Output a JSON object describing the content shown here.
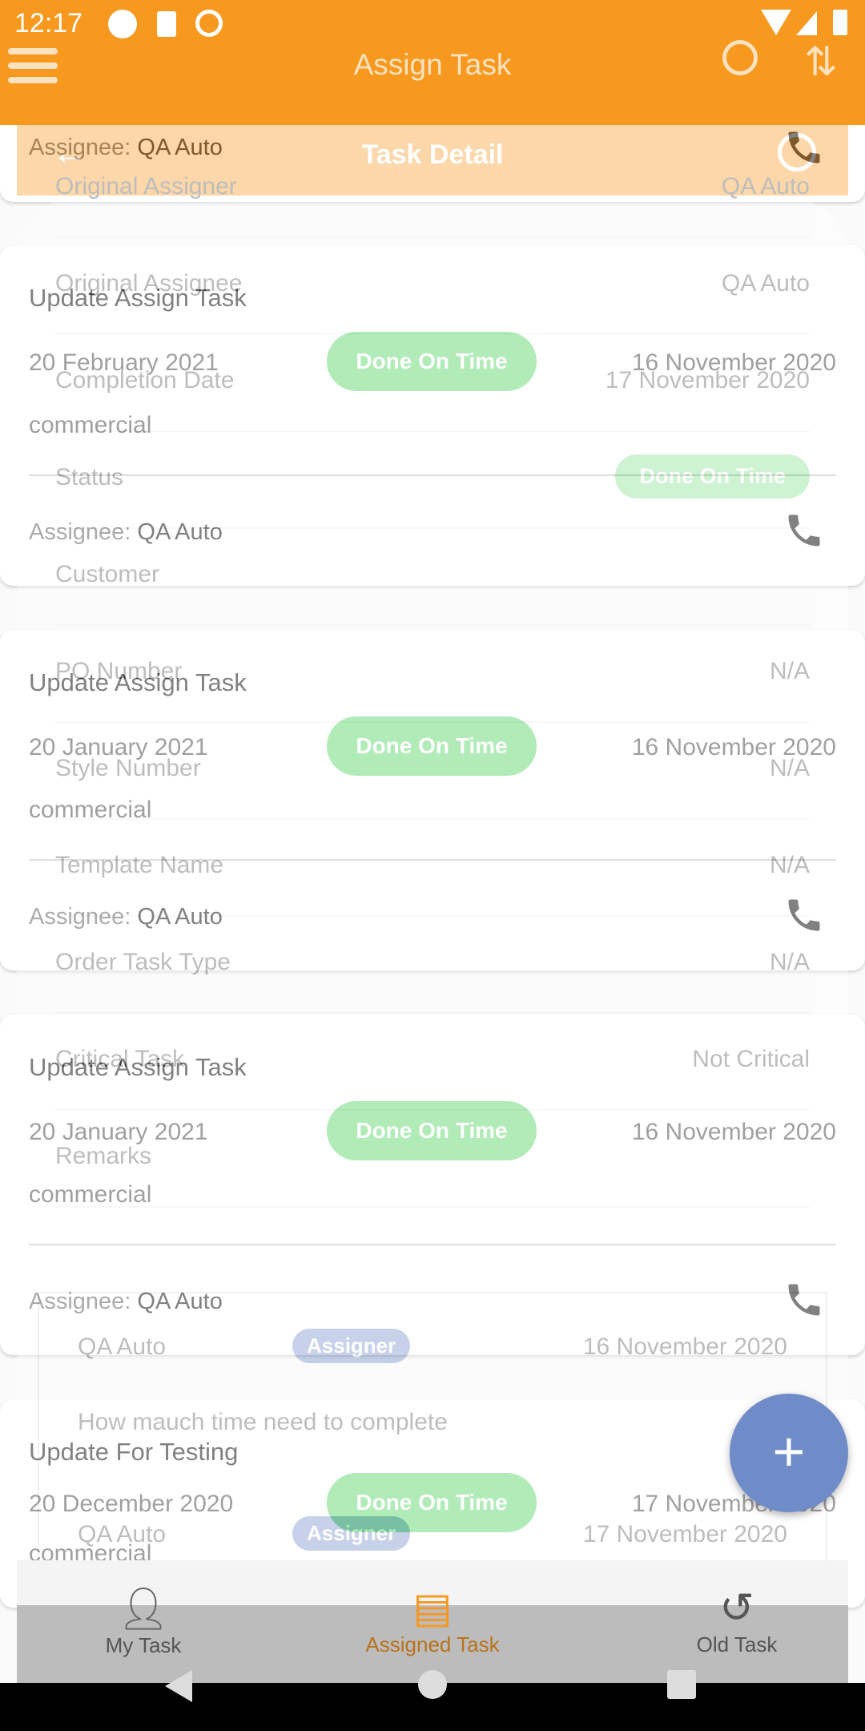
{
  "status_bar": {
    "time": "12:17"
  },
  "app_bar": {
    "title": "Assign Task"
  },
  "tasks": [
    {
      "assignee_label": "Assignee:",
      "assignee": "QA Auto"
    },
    {
      "title": "Update Assign Task",
      "due": "20 February 2021",
      "status": "Done On Time",
      "created": "16 November 2020",
      "category": "commercial",
      "assignee_label": "Assignee:",
      "assignee": "QA Auto"
    },
    {
      "title": "Update Assign Task",
      "due": "20 January 2021",
      "status": "Done On Time",
      "created": "16 November 2020",
      "category": "commercial",
      "assignee_label": "Assignee:",
      "assignee": "QA Auto"
    },
    {
      "title": "Update Assign Task",
      "due": "20 January 2021",
      "status": "Done On Time",
      "created": "16 November 2020",
      "category": "commercial",
      "assignee_label": "Assignee:",
      "assignee": "QA Auto"
    },
    {
      "title": "Update For Testing",
      "due": "20 December 2020",
      "status": "Done On Time",
      "created": "17 November 2020",
      "category": "commercial"
    }
  ],
  "detail": {
    "title": "Task Detail",
    "rows": [
      {
        "label": "Original Assigner",
        "value": "QA Auto"
      },
      {
        "label": "Original Assignee",
        "value": "QA Auto"
      },
      {
        "label": "Completion Date",
        "value": "17 November 2020"
      },
      {
        "label": "Status",
        "value": "Done On Time"
      },
      {
        "label": "Customer",
        "value": ""
      },
      {
        "label": "PO Number",
        "value": "N/A"
      },
      {
        "label": "Style Number",
        "value": "N/A"
      },
      {
        "label": "Template Name",
        "value": "N/A"
      },
      {
        "label": "Order Task Type",
        "value": "N/A"
      },
      {
        "label": "Critical Task",
        "value": "Not Critical"
      },
      {
        "label": "Remarks",
        "value": ""
      }
    ],
    "comments": [
      {
        "user": "QA Auto",
        "role": "Assigner",
        "date": "16 November 2020",
        "text": "How mauch time need to complete"
      },
      {
        "user": "QA Auto",
        "role": "Assigner",
        "date": "17 November 2020"
      }
    ]
  },
  "bottom_nav": [
    {
      "label": "My Task"
    },
    {
      "label": "Assigned Task"
    },
    {
      "label": "Old Task"
    }
  ],
  "colors": {
    "primary": "#f7981f",
    "done": "#7fe08d",
    "fab": "#6f8cc9"
  }
}
